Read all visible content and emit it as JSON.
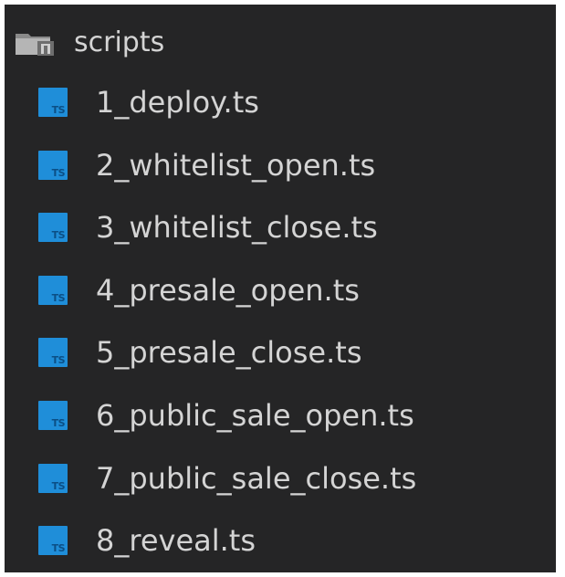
{
  "explorer": {
    "folder": {
      "label": "scripts",
      "icon": "folder-icon"
    },
    "files": [
      {
        "label": "1_deploy.ts",
        "icon": "typescript-file-icon",
        "badge": "TS"
      },
      {
        "label": "2_whitelist_open.ts",
        "icon": "typescript-file-icon",
        "badge": "TS"
      },
      {
        "label": "3_whitelist_close.ts",
        "icon": "typescript-file-icon",
        "badge": "TS"
      },
      {
        "label": "4_presale_open.ts",
        "icon": "typescript-file-icon",
        "badge": "TS"
      },
      {
        "label": "5_presale_close.ts",
        "icon": "typescript-file-icon",
        "badge": "TS"
      },
      {
        "label": "6_public_sale_open.ts",
        "icon": "typescript-file-icon",
        "badge": "TS"
      },
      {
        "label": "7_public_sale_close.ts",
        "icon": "typescript-file-icon",
        "badge": "TS"
      },
      {
        "label": "8_reveal.ts",
        "icon": "typescript-file-icon",
        "badge": "TS"
      }
    ]
  },
  "colors": {
    "background": "#252526",
    "text": "#d4d4d4",
    "ts_icon": "#1f8ed9"
  }
}
